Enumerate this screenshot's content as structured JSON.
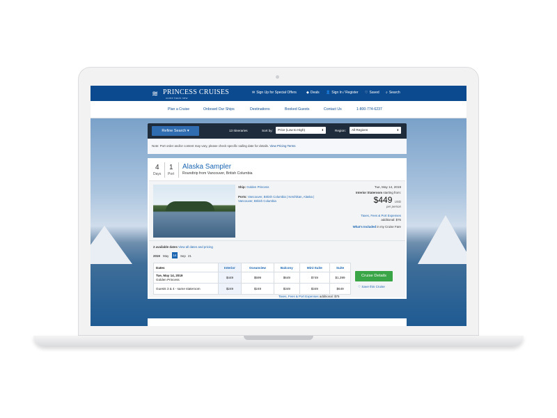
{
  "header": {
    "logo_name": "PRINCESS CRUISES",
    "logo_tagline": "come back new",
    "utility": [
      "Sign Up for Special Offers",
      "Deals",
      "Sign In / Register",
      "Saved",
      "Search"
    ],
    "nav": [
      "Plan a Cruise",
      "Onboard Our Ships",
      "Destinations",
      "Booked Guests",
      "Contact Us",
      "1-800-774-6237"
    ]
  },
  "filters": {
    "refine_label": "Refine Search",
    "count": "13 Itineraries",
    "sort_label": "Sort by:",
    "sort_value": "Price (Low to High)",
    "region_label": "Region:",
    "region_value": "All Regions"
  },
  "notice": {
    "text": "Note: Port order and/or content may vary, please check specific sailing date for details.",
    "link": "View Pricing Terms"
  },
  "cruise": {
    "days": "4",
    "days_label": "Days",
    "ports": "1",
    "ports_label": "Port",
    "title": "Alaska Sampler",
    "subtitle": "Roundtrip from Vancouver, British Columbia",
    "ship_label": "Ship:",
    "ship": "Golden Princess",
    "ports_list_label": "Ports:",
    "ports_list": "Vancouver, British Columbia | Ketchikan, Alaska | Vancouver, British Columbia",
    "date": "Tue, May 14, 2019",
    "stateroom": "Interior Stateroom",
    "starting_from": "starting from:",
    "price": "$449",
    "currency": "USD",
    "per_person": "per person",
    "taxes_link": "Taxes, Fees & Port Expenses",
    "additional": "additional: $75",
    "included_link": "What's Included",
    "included_rest": "in my Cruise Fare"
  },
  "dates": {
    "available": "2 available dates",
    "view_all": "View all dates and pricing",
    "year": "2019",
    "months": [
      "May",
      "14",
      "Sep",
      "21"
    ],
    "columns": [
      "Dates",
      "Interior",
      "Oceanview",
      "Balcony",
      "Mini-Suite",
      "Suite"
    ],
    "rows": [
      {
        "label": "Tue, May 14, 2019",
        "sub": "Golden Princess",
        "values": [
          "$449",
          "$599",
          "$649",
          "$749",
          "$1,399"
        ]
      },
      {
        "label": "Guests 3 & 4 - same stateroom",
        "sub": "",
        "values": [
          "$249",
          "$249",
          "$349",
          "$349",
          "$649"
        ]
      }
    ],
    "details_button": "Cruise Details",
    "save_label": "Save this Cruise",
    "tax_link": "Taxes, Fees & Port Expenses",
    "tax_additional": "additional: $75"
  }
}
